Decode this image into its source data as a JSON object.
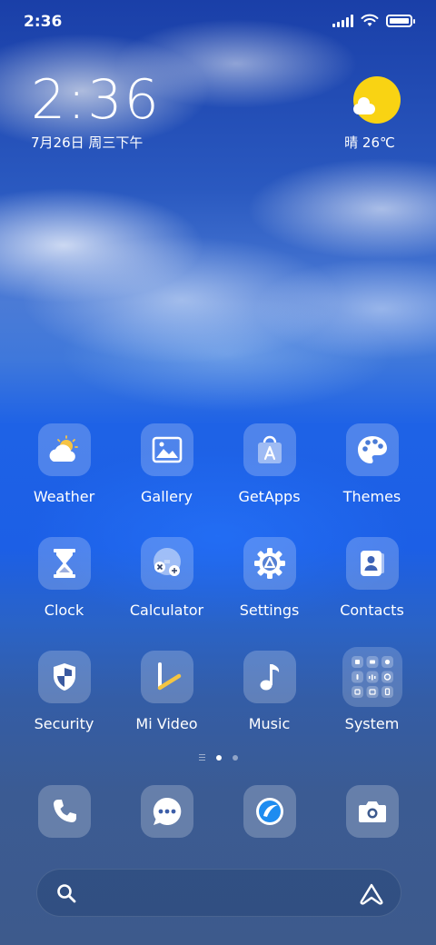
{
  "status_bar": {
    "time": "2:36"
  },
  "clock_widget": {
    "time": "2:36",
    "date": "7月26日 周三下午"
  },
  "weather_widget": {
    "text": "晴 26℃",
    "icon": "sun-cloud-icon"
  },
  "apps": [
    {
      "label": "Weather",
      "icon": "weather-icon"
    },
    {
      "label": "Gallery",
      "icon": "gallery-icon"
    },
    {
      "label": "GetApps",
      "icon": "getapps-icon"
    },
    {
      "label": "Themes",
      "icon": "themes-icon"
    },
    {
      "label": "Clock",
      "icon": "clock-icon"
    },
    {
      "label": "Calculator",
      "icon": "calculator-icon"
    },
    {
      "label": "Settings",
      "icon": "settings-icon"
    },
    {
      "label": "Contacts",
      "icon": "contacts-icon"
    },
    {
      "label": "Security",
      "icon": "security-icon"
    },
    {
      "label": "Mi Video",
      "icon": "mi-video-icon"
    },
    {
      "label": "Music",
      "icon": "music-icon"
    },
    {
      "label": "System",
      "icon": "system-folder-icon"
    }
  ],
  "dock": [
    {
      "icon": "phone-icon"
    },
    {
      "icon": "messages-icon"
    },
    {
      "icon": "browser-icon"
    },
    {
      "icon": "camera-icon"
    }
  ],
  "colors": {
    "sun": "#f9d313",
    "mi_video_accent": "#f4c542"
  }
}
